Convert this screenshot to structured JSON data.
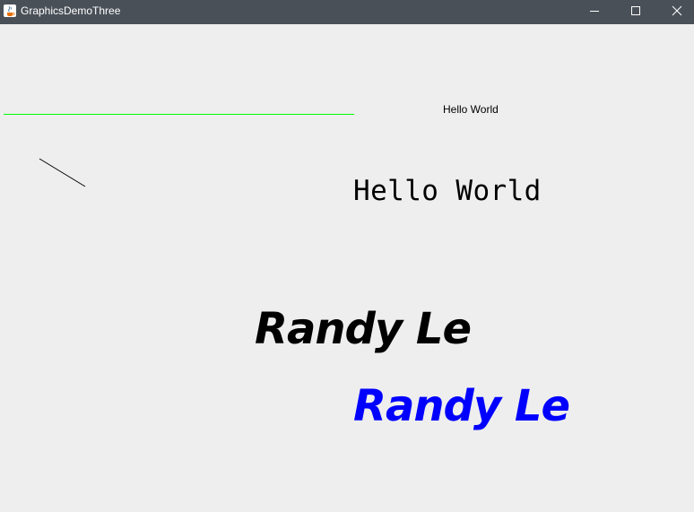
{
  "window": {
    "title": "GraphicsDemoThree",
    "icon": "java-app-icon",
    "controls": [
      "minimize-icon",
      "maximize-icon",
      "close-icon"
    ]
  },
  "canvas": {
    "background": "#eeeeee",
    "lines": [
      {
        "name": "green-line",
        "color": "#00ff00"
      },
      {
        "name": "diagonal-line",
        "color": "#000000"
      }
    ],
    "texts": {
      "hello_small": "Hello World",
      "hello_mono": "Hello World",
      "randy_black": "Randy Le",
      "randy_blue": "Randy Le"
    },
    "colors": {
      "randy_black": "#000000",
      "randy_blue": "#0000ff"
    }
  }
}
